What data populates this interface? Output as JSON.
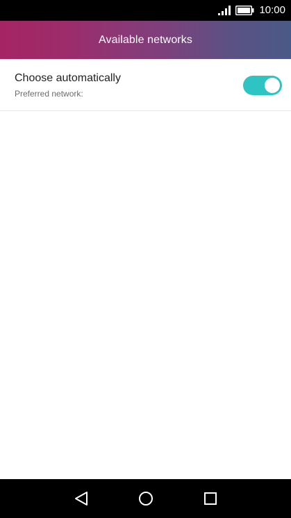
{
  "status_bar": {
    "time": "10:00",
    "icons": [
      "signal-icon",
      "battery-icon"
    ]
  },
  "app_bar": {
    "title": "Available networks",
    "gradient_colors": [
      "#a52463",
      "#4a5a88"
    ]
  },
  "settings": {
    "choose_automatically": {
      "title": "Choose automatically",
      "subtitle": "Preferred network:",
      "toggle_on": true,
      "toggle_color": "#2ec4c4"
    }
  },
  "nav_bar": {
    "buttons": [
      "back-icon",
      "home-icon",
      "recent-apps-icon"
    ]
  }
}
